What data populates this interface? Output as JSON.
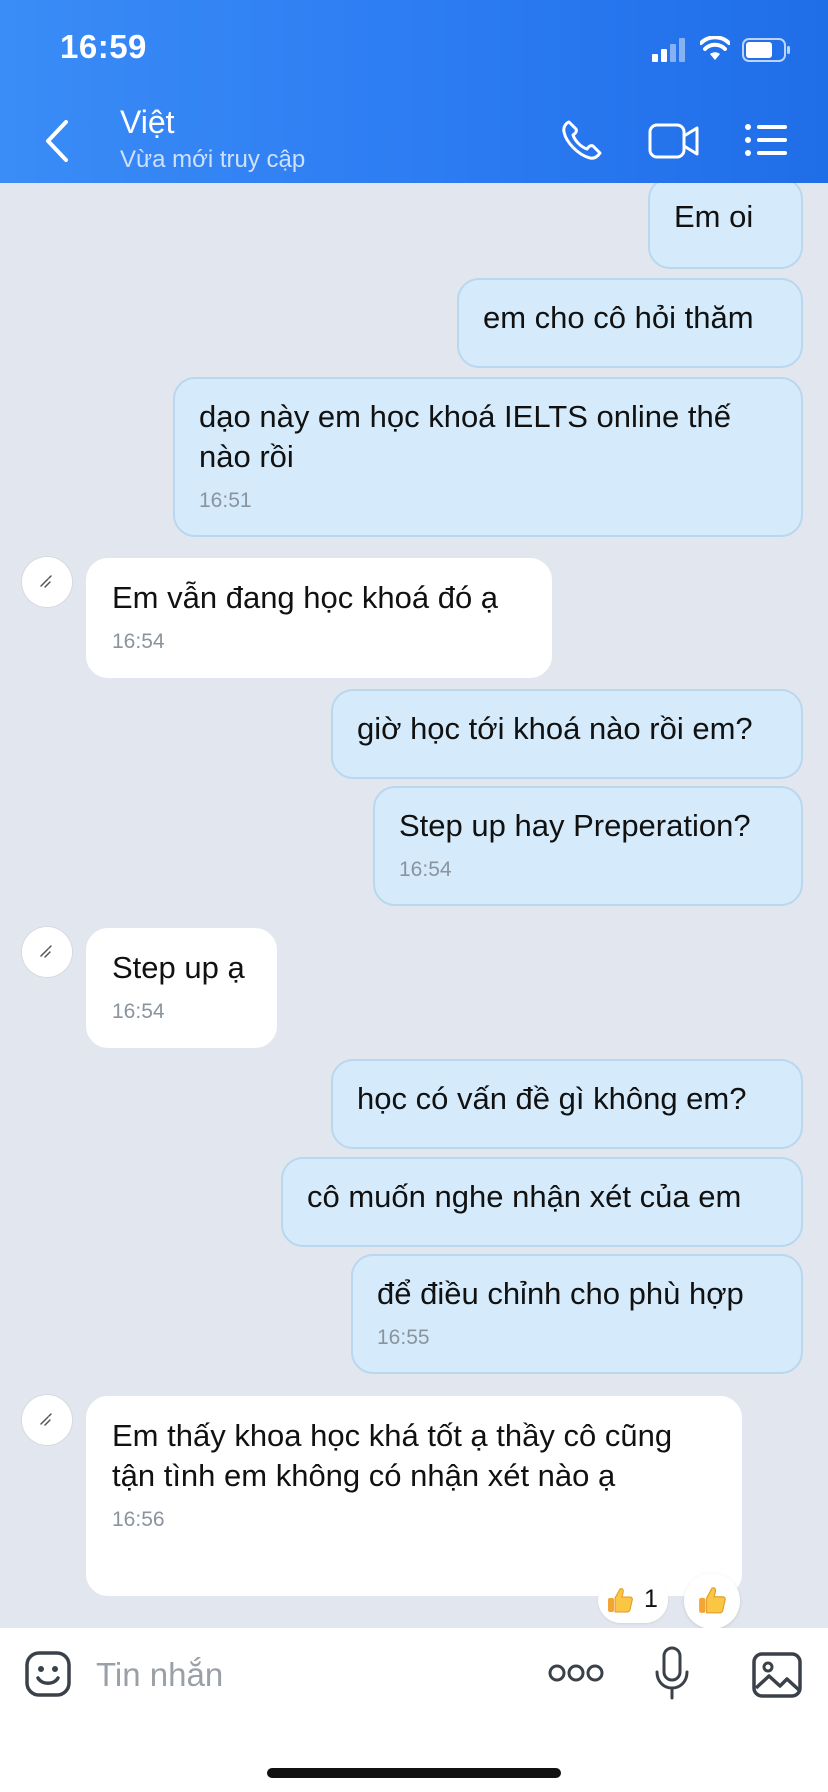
{
  "status_bar": {
    "time": "16:59"
  },
  "header": {
    "contact_name": "Việt",
    "contact_status": "Vừa mới truy cập",
    "icons": [
      "back-chevron-icon",
      "phone-icon",
      "video-camera-icon",
      "list-menu-icon"
    ]
  },
  "messages": [
    {
      "sender": "me",
      "text": "Em oi",
      "time": ""
    },
    {
      "sender": "me",
      "text": "em cho cô hỏi thăm",
      "time": ""
    },
    {
      "sender": "me",
      "text": "dạo này em học khoá IELTS online thế nào rồi",
      "time": "16:51"
    },
    {
      "sender": "contact",
      "text": "Em vẫn đang học khoá đó ạ",
      "time": "16:54"
    },
    {
      "sender": "me",
      "text": "giờ học tới khoá nào rồi em?",
      "time": ""
    },
    {
      "sender": "me",
      "text": "Step up hay Preperation?",
      "time": "16:54"
    },
    {
      "sender": "contact",
      "text": "Step up ạ",
      "time": "16:54"
    },
    {
      "sender": "me",
      "text": "học có vấn đề gì không em?",
      "time": ""
    },
    {
      "sender": "me",
      "text": "cô muốn nghe nhận xét của em",
      "time": ""
    },
    {
      "sender": "me",
      "text": "để điều chỉnh cho phù hợp",
      "time": "16:55"
    },
    {
      "sender": "contact",
      "text": "Em thấy khoa học khá tốt ạ thầy cô cũng tận tình em không có nhận xét nào ạ",
      "time": "16:56"
    }
  ],
  "reaction": {
    "emoji": "thumbs-up-icon",
    "count": "1"
  },
  "input_bar": {
    "placeholder": "Tin nhắn",
    "icons": [
      "emoji-icon",
      "more-dots-icon",
      "microphone-icon",
      "image-icon"
    ]
  },
  "colors": {
    "header_blue": "#2c7bf2",
    "chat_background": "#e2e6ee",
    "my_bubble": "#d5ebfb",
    "contact_bubble": "#ffffff"
  }
}
